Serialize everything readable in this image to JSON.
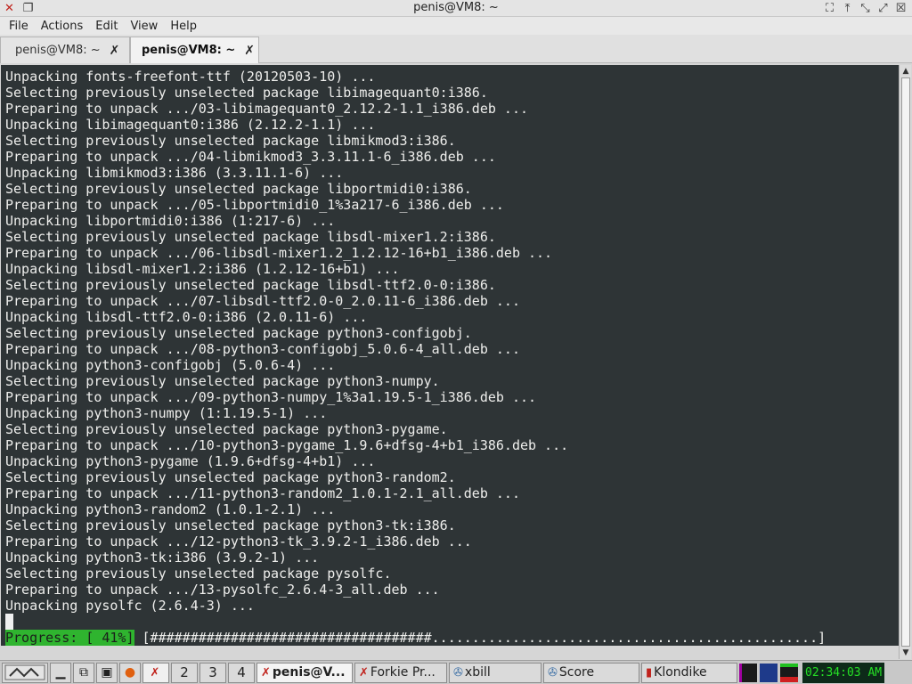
{
  "window": {
    "title": "penis@VM8: ~"
  },
  "menu": [
    "File",
    "Actions",
    "Edit",
    "View",
    "Help"
  ],
  "tabs": [
    {
      "label": "penis@VM8: ~",
      "active": false
    },
    {
      "label": "penis@VM8: ~",
      "active": true
    }
  ],
  "terminal": {
    "lines": [
      "Unpacking fonts-freefont-ttf (20120503-10) ...",
      "Selecting previously unselected package libimagequant0:i386.",
      "Preparing to unpack .../03-libimagequant0_2.12.2-1.1_i386.deb ...",
      "Unpacking libimagequant0:i386 (2.12.2-1.1) ...",
      "Selecting previously unselected package libmikmod3:i386.",
      "Preparing to unpack .../04-libmikmod3_3.3.11.1-6_i386.deb ...",
      "Unpacking libmikmod3:i386 (3.3.11.1-6) ...",
      "Selecting previously unselected package libportmidi0:i386.",
      "Preparing to unpack .../05-libportmidi0_1%3a217-6_i386.deb ...",
      "Unpacking libportmidi0:i386 (1:217-6) ...",
      "Selecting previously unselected package libsdl-mixer1.2:i386.",
      "Preparing to unpack .../06-libsdl-mixer1.2_1.2.12-16+b1_i386.deb ...",
      "Unpacking libsdl-mixer1.2:i386 (1.2.12-16+b1) ...",
      "Selecting previously unselected package libsdl-ttf2.0-0:i386.",
      "Preparing to unpack .../07-libsdl-ttf2.0-0_2.0.11-6_i386.deb ...",
      "Unpacking libsdl-ttf2.0-0:i386 (2.0.11-6) ...",
      "Selecting previously unselected package python3-configobj.",
      "Preparing to unpack .../08-python3-configobj_5.0.6-4_all.deb ...",
      "Unpacking python3-configobj (5.0.6-4) ...",
      "Selecting previously unselected package python3-numpy.",
      "Preparing to unpack .../09-python3-numpy_1%3a1.19.5-1_i386.deb ...",
      "Unpacking python3-numpy (1:1.19.5-1) ...",
      "Selecting previously unselected package python3-pygame.",
      "Preparing to unpack .../10-python3-pygame_1.9.6+dfsg-4+b1_i386.deb ...",
      "Unpacking python3-pygame (1.9.6+dfsg-4+b1) ...",
      "Selecting previously unselected package python3-random2.",
      "Preparing to unpack .../11-python3-random2_1.0.1-2.1_all.deb ...",
      "Unpacking python3-random2 (1.0.1-2.1) ...",
      "Selecting previously unselected package python3-tk:i386.",
      "Preparing to unpack .../12-python3-tk_3.9.2-1_i386.deb ...",
      "Unpacking python3-tk:i386 (3.9.2-1) ...",
      "Selecting previously unselected package pysolfc.",
      "Preparing to unpack .../13-pysolfc_2.6.4-3_all.deb ...",
      "Unpacking pysolfc (2.6.4-3) ..."
    ],
    "progress_label": "Progress: [ 41%]",
    "progress_bar": " [###################################................................................] ",
    "progress_percent": 41
  },
  "taskbar": {
    "workspaces": [
      "2",
      "3",
      "4"
    ],
    "windows": [
      {
        "label": "penis@V...",
        "active": true,
        "icon": "terminal-icon"
      },
      {
        "label": "Forkie Pr...",
        "active": false,
        "icon": "x-icon"
      },
      {
        "label": "xbill",
        "active": false,
        "icon": "xbill-icon"
      },
      {
        "label": "Score",
        "active": false,
        "icon": "score-icon"
      },
      {
        "label": "Klondike",
        "active": false,
        "icon": "cards-icon"
      }
    ],
    "clock": "02:34:03 AM"
  },
  "colors": {
    "terminal_bg": "#2e3436",
    "terminal_fg": "#eeeeec",
    "progress_green": "#2fb42f",
    "clock_fg": "#25e025"
  }
}
